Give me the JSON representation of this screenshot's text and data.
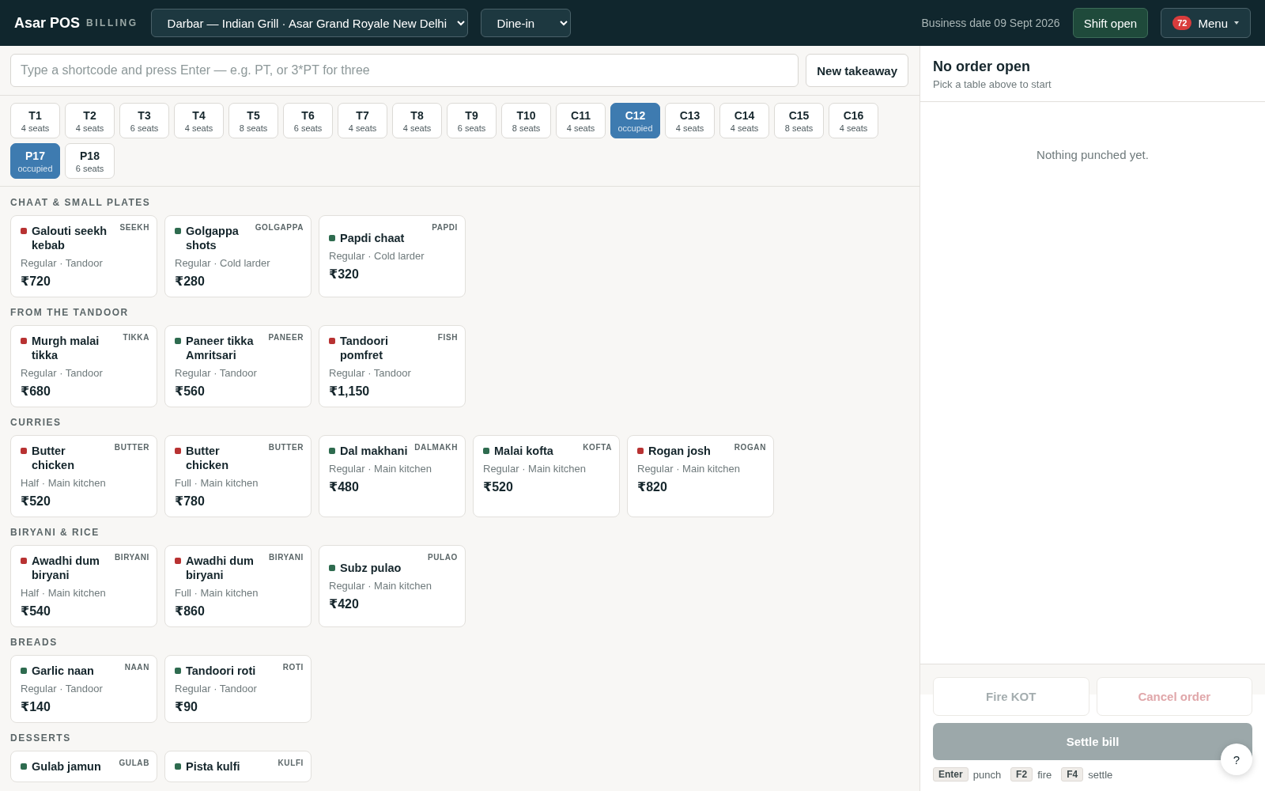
{
  "header": {
    "brand": "Asar POS",
    "brand_sub": "BILLING",
    "outlet": "Darbar — Indian Grill · Asar Grand Royale New Delhi",
    "service": "Dine-in",
    "business_date": "Business date 09 Sept 2026",
    "shift_button": "Shift open",
    "menu_badge": "72",
    "menu_button": "Menu"
  },
  "search": {
    "placeholder": "Type a shortcode and press Enter — e.g. PT, or 3*PT for three"
  },
  "new_takeaway": "New takeaway",
  "tables": [
    {
      "name": "T1",
      "info": "4 seats",
      "selected": false
    },
    {
      "name": "T2",
      "info": "4 seats",
      "selected": false
    },
    {
      "name": "T3",
      "info": "6 seats",
      "selected": false
    },
    {
      "name": "T4",
      "info": "4 seats",
      "selected": false
    },
    {
      "name": "T5",
      "info": "8 seats",
      "selected": false
    },
    {
      "name": "T6",
      "info": "6 seats",
      "selected": false
    },
    {
      "name": "T7",
      "info": "4 seats",
      "selected": false
    },
    {
      "name": "T8",
      "info": "4 seats",
      "selected": false
    },
    {
      "name": "T9",
      "info": "6 seats",
      "selected": false
    },
    {
      "name": "T10",
      "info": "8 seats",
      "selected": false
    },
    {
      "name": "C11",
      "info": "4 seats",
      "selected": false
    },
    {
      "name": "C12",
      "info": "occupied",
      "selected": true
    },
    {
      "name": "C13",
      "info": "4 seats",
      "selected": false
    },
    {
      "name": "C14",
      "info": "4 seats",
      "selected": false
    },
    {
      "name": "C15",
      "info": "8 seats",
      "selected": false
    },
    {
      "name": "C16",
      "info": "4 seats",
      "selected": false
    },
    {
      "name": "P17",
      "info": "occupied",
      "selected": true
    },
    {
      "name": "P18",
      "info": "6 seats",
      "selected": false
    }
  ],
  "sections": [
    {
      "title": "CHAAT & SMALL PLATES",
      "items": [
        {
          "name": "Galouti seekh kebab",
          "code": "SEEKH",
          "detail": "Regular · Tandoor",
          "price": "₹720",
          "color": "#b83232"
        },
        {
          "name": "Golgappa shots",
          "code": "GOLGAPPA",
          "detail": "Regular · Cold larder",
          "price": "₹280",
          "color": "#2e6b4f"
        },
        {
          "name": "Papdi chaat",
          "code": "PAPDI",
          "detail": "Regular · Cold larder",
          "price": "₹320",
          "color": "#2e6b4f"
        }
      ]
    },
    {
      "title": "FROM THE TANDOOR",
      "items": [
        {
          "name": "Murgh malai tikka",
          "code": "TIKKA",
          "detail": "Regular · Tandoor",
          "price": "₹680",
          "color": "#b83232"
        },
        {
          "name": "Paneer tikka Amritsari",
          "code": "PANEER",
          "detail": "Regular · Tandoor",
          "price": "₹560",
          "color": "#2e6b4f"
        },
        {
          "name": "Tandoori pomfret",
          "code": "FISH",
          "detail": "Regular · Tandoor",
          "price": "₹1,150",
          "color": "#b83232"
        }
      ]
    },
    {
      "title": "CURRIES",
      "items": [
        {
          "name": "Butter chicken",
          "code": "BUTTER",
          "detail": "Half · Main kitchen",
          "price": "₹520",
          "color": "#b83232"
        },
        {
          "name": "Butter chicken",
          "code": "BUTTER",
          "detail": "Full · Main kitchen",
          "price": "₹780",
          "color": "#b83232"
        },
        {
          "name": "Dal makhani",
          "code": "DALMAKH",
          "detail": "Regular · Main kitchen",
          "price": "₹480",
          "color": "#2e6b4f"
        },
        {
          "name": "Malai kofta",
          "code": "KOFTA",
          "detail": "Regular · Main kitchen",
          "price": "₹520",
          "color": "#2e6b4f"
        },
        {
          "name": "Rogan josh",
          "code": "ROGAN",
          "detail": "Regular · Main kitchen",
          "price": "₹820",
          "color": "#b83232"
        }
      ]
    },
    {
      "title": "BIRYANI & RICE",
      "items": [
        {
          "name": "Awadhi dum biryani",
          "code": "BIRYANI",
          "detail": "Half · Main kitchen",
          "price": "₹540",
          "color": "#b83232"
        },
        {
          "name": "Awadhi dum biryani",
          "code": "BIRYANI",
          "detail": "Full · Main kitchen",
          "price": "₹860",
          "color": "#b83232"
        },
        {
          "name": "Subz pulao",
          "code": "PULAO",
          "detail": "Regular · Main kitchen",
          "price": "₹420",
          "color": "#2e6b4f"
        }
      ]
    },
    {
      "title": "BREADS",
      "items": [
        {
          "name": "Garlic naan",
          "code": "NAAN",
          "detail": "Regular · Tandoor",
          "price": "₹140",
          "color": "#2e6b4f"
        },
        {
          "name": "Tandoori roti",
          "code": "ROTI",
          "detail": "Regular · Tandoor",
          "price": "₹90",
          "color": "#2e6b4f"
        }
      ]
    },
    {
      "title": "DESSERTS",
      "items": [
        {
          "name": "Gulab jamun",
          "code": "GULAB",
          "color": "#2e6b4f"
        },
        {
          "name": "Pista kulfi",
          "code": "KULFI",
          "color": "#2e6b4f"
        }
      ]
    }
  ],
  "order": {
    "title": "No order open",
    "subtitle": "Pick a table above to start",
    "empty": "Nothing punched yet.",
    "actions": [
      {
        "label": "Fire KOT",
        "kind": "neutral",
        "disabled": true
      },
      {
        "label": "Cancel order",
        "kind": "danger",
        "disabled": true
      }
    ],
    "settle": {
      "label": "Settle bill",
      "disabled": true
    },
    "shortcuts": [
      {
        "key": "Enter",
        "action": "punch"
      },
      {
        "key": "F2",
        "action": "fire"
      },
      {
        "key": "F4",
        "action": "settle"
      }
    ],
    "help": "?"
  }
}
